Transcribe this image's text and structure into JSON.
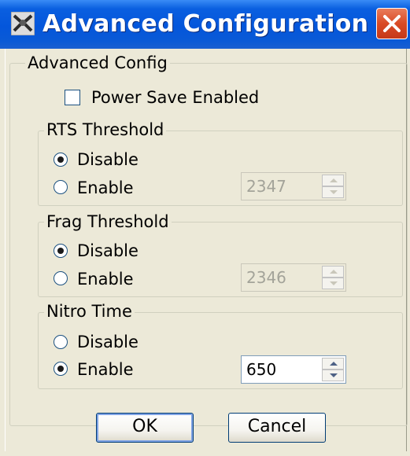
{
  "window": {
    "title": "Advanced Configuration",
    "icon": "app-logo-icon",
    "close_icon": "close-icon"
  },
  "advanced": {
    "label": "Advanced Config",
    "power_save": {
      "label": "Power Save Enabled",
      "checked": false
    }
  },
  "rts": {
    "label": "RTS Threshold",
    "disable_label": "Disable",
    "enable_label": "Enable",
    "selected": "Disable",
    "value": "2347",
    "enabled": false
  },
  "frag": {
    "label": "Frag Threshold",
    "disable_label": "Disable",
    "enable_label": "Enable",
    "selected": "Disable",
    "value": "2346",
    "enabled": false
  },
  "nitro": {
    "label": "Nitro Time",
    "disable_label": "Disable",
    "enable_label": "Enable",
    "selected": "Enable",
    "value": "650",
    "enabled": true
  },
  "buttons": {
    "ok_label": "OK",
    "cancel_label": "Cancel"
  },
  "colors": {
    "titlebar": "#0456db",
    "close_button": "#d94a25",
    "dialog_bg": "#ece9d8"
  }
}
